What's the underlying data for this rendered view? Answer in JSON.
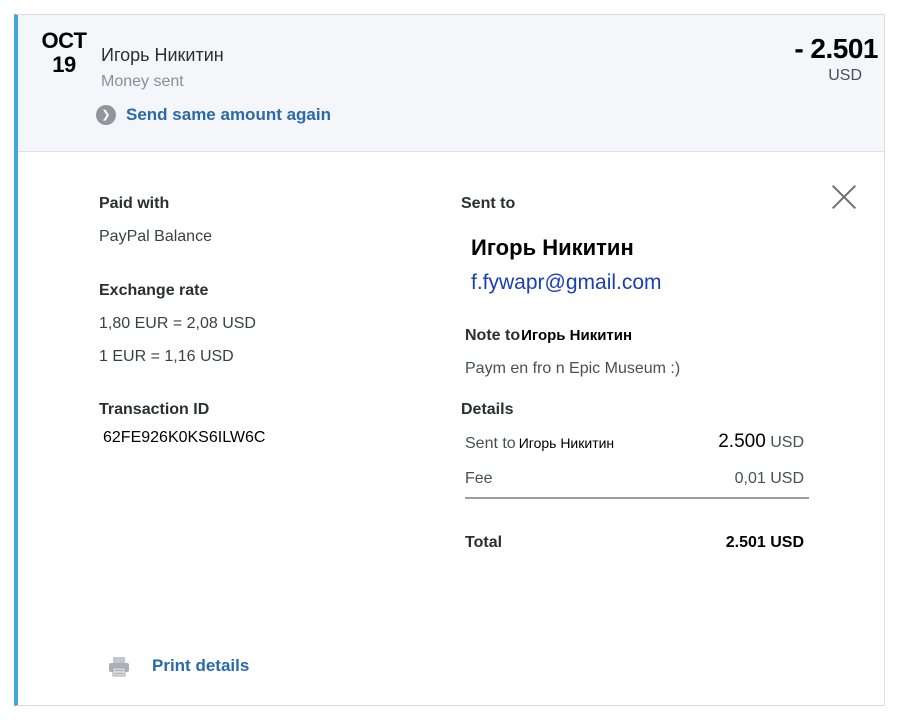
{
  "header": {
    "month": "OCT",
    "day": "19",
    "name": "Игорь Никитин",
    "status": "Money sent",
    "send_again": "Send same amount again",
    "amount": "- 2.501",
    "currency": "USD"
  },
  "paid_with": {
    "label": "Paid with",
    "value": "PayPal Balance"
  },
  "exchange": {
    "label": "Exchange rate",
    "line1": "1,80 EUR = 2,08 USD",
    "line2": "1 EUR = 1,16 USD"
  },
  "transaction": {
    "label": "Transaction ID",
    "value": "62FE926K0KS6ILW6C"
  },
  "sent_to": {
    "label": "Sent to",
    "name": "Игорь Никитин",
    "email": "f.fywapr@gmail.com"
  },
  "note": {
    "label": "Note to",
    "name": "Игорь Никитин",
    "text": "Paym en  fro n Epic Museum :)"
  },
  "details": {
    "label": "Details",
    "sent_label": "Sent to",
    "sent_name": "Игорь Никитин",
    "sent_amount": "2.500",
    "sent_currency": "USD",
    "fee_label": "Fee",
    "fee_value": "0,01 USD",
    "total_label": "Total",
    "total_value": "2.501 USD"
  },
  "print": {
    "label": "Print details"
  },
  "icons": {
    "send_again": "chevron-right-icon",
    "close": "close-icon",
    "print": "printer-icon"
  },
  "colors": {
    "accent": "#3da7e0",
    "link": "#2a6aa8",
    "email": "#1a3fb5"
  }
}
